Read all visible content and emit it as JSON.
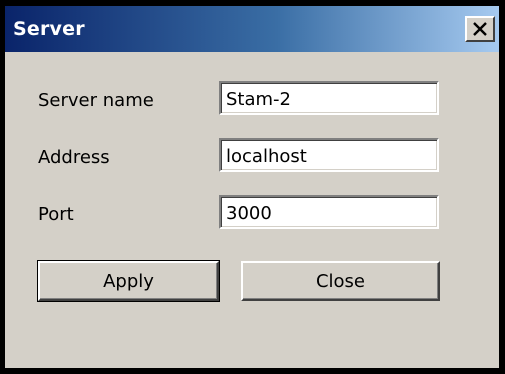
{
  "window": {
    "title": "Server",
    "close_glyph": "×"
  },
  "form": {
    "server_name": {
      "label": "Server name",
      "value": "Stam-2"
    },
    "address": {
      "label": "Address",
      "value": "localhost"
    },
    "port": {
      "label": "Port",
      "value": "3000"
    }
  },
  "buttons": {
    "apply_label": "Apply",
    "close_label": "Close"
  },
  "colors": {
    "titlebar_start": "#0a246a",
    "titlebar_end": "#a6caf0",
    "face": "#d4d0c8"
  }
}
